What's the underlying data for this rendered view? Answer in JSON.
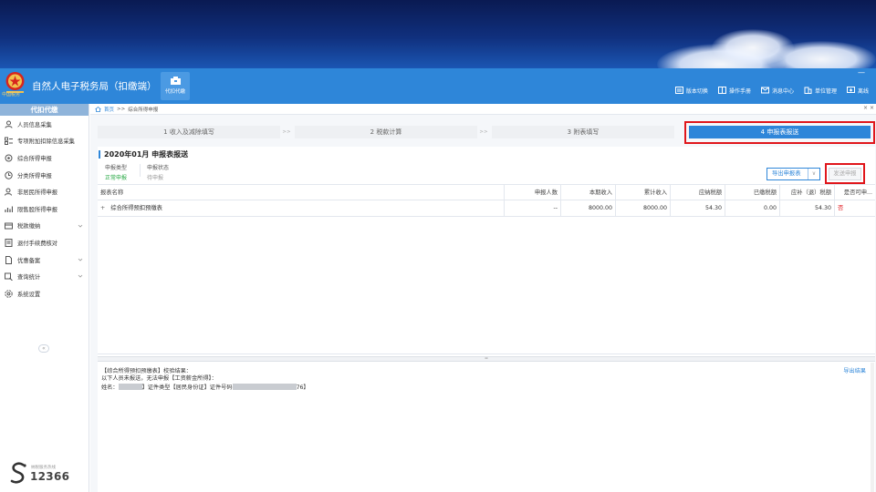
{
  "app": {
    "title": "自然人电子税务局（扣缴端）",
    "agent_button_label": "代扣代缴",
    "seal_text": "中国税务",
    "window_min": "—",
    "top_links": [
      {
        "label": "版本切换",
        "icon": "switch-icon"
      },
      {
        "label": "操作手册",
        "icon": "manual-icon"
      },
      {
        "label": "消息中心",
        "icon": "message-icon"
      },
      {
        "label": "单位管理",
        "icon": "building-icon"
      },
      {
        "label": "离线",
        "icon": "offline-icon"
      }
    ]
  },
  "sidebar": {
    "header": "代扣代缴",
    "items": [
      {
        "label": "人员信息采集",
        "icon": "person-icon",
        "expandable": false
      },
      {
        "label": "专项附加扣除信息采集",
        "icon": "list-icon",
        "expandable": false
      },
      {
        "label": "综合所得申报",
        "icon": "gear-icon",
        "expandable": false
      },
      {
        "label": "分类所得申报",
        "icon": "clock-icon",
        "expandable": false
      },
      {
        "label": "非居民所得申报",
        "icon": "user-icon",
        "expandable": false
      },
      {
        "label": "限售股所得申报",
        "icon": "chart-icon",
        "expandable": false
      },
      {
        "label": "税款缴纳",
        "icon": "wallet-icon",
        "expandable": true
      },
      {
        "label": "退付手续费核对",
        "icon": "document-icon",
        "expandable": false
      },
      {
        "label": "优惠备案",
        "icon": "file-icon",
        "expandable": true
      },
      {
        "label": "查询统计",
        "icon": "search-icon",
        "expandable": true
      },
      {
        "label": "系统设置",
        "icon": "settings-icon",
        "expandable": false
      }
    ],
    "collapse_glyph": "«",
    "hotline_caption": "纳税服务热线",
    "hotline_number": "12366"
  },
  "breadcrumb": {
    "home": "首页",
    "separator": ">>",
    "current": "综合所得申报",
    "close": "× ×"
  },
  "steps": [
    {
      "label": "1 收入及减除填写",
      "active": false
    },
    {
      "label": "2 税款计算",
      "active": false
    },
    {
      "label": "3 附表填写",
      "active": false
    },
    {
      "label": "4 申报表报送",
      "active": true
    }
  ],
  "step_separator": ">>",
  "period": {
    "title": "2020年01月  申报表报送",
    "type_label": "申报类型",
    "type_value": "正常申报",
    "status_label": "申报状态",
    "status_value": "待申报"
  },
  "actions": {
    "export_label": "导出申报表",
    "export_dropdown": "∨",
    "send_label": "发送申报"
  },
  "table": {
    "headers": [
      "报表名称",
      "申报人数",
      "本期收入",
      "累计收入",
      "应纳税额",
      "已缴税额",
      "应补（退）税额",
      "是否可申..."
    ],
    "rows": [
      {
        "expand": "+",
        "name": "综合所得预扣预缴表",
        "people": "--",
        "income": "8000.00",
        "cumulative": "8000.00",
        "tax_due": "54.30",
        "tax_paid": "0.00",
        "tax_diff": "54.30",
        "can_declare": "否"
      }
    ]
  },
  "splitter_glyph": "═",
  "result": {
    "line1": "【综合所得预扣预缴表】校验结果：",
    "line2": "以下人员未报送，无法申报【工资薪金所得】：",
    "name_label": "姓名：",
    "line3_mid": "】证件类型【居民身份证】证件号码",
    "line3_end": "76】",
    "export_link": "导出结果"
  },
  "colors": {
    "primary": "#2e86d9",
    "highlight": "#e0161b",
    "success": "#27a844",
    "danger": "#e0161b"
  }
}
